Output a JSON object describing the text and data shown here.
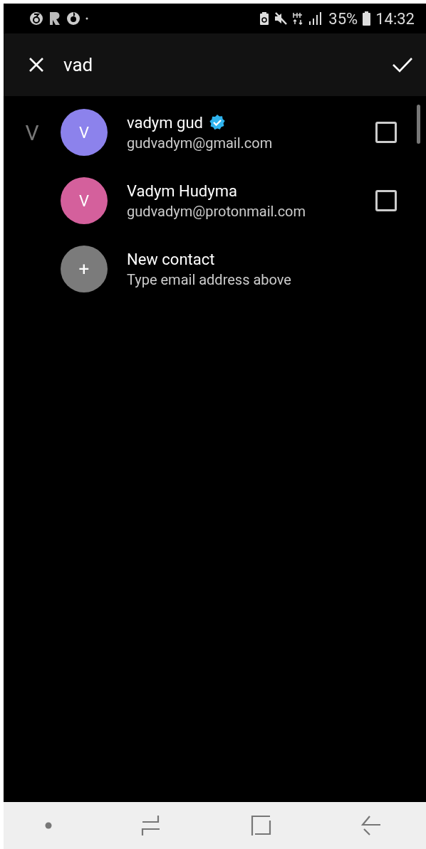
{
  "status_bar": {
    "battery_percent": "35%",
    "time": "14:32"
  },
  "search": {
    "value": "vad"
  },
  "section": {
    "letter": "V"
  },
  "contacts": [
    {
      "kind": "contact",
      "initial": "V",
      "name": "vadym gud",
      "verified": true,
      "email": "gudvadym@gmail.com",
      "color": "#8c82ec",
      "checked": false
    },
    {
      "kind": "contact",
      "initial": "V",
      "name": "Vadym Hudyma",
      "verified": false,
      "email": "gudvadym@protonmail.com",
      "color": "#d4609c",
      "checked": false
    },
    {
      "kind": "new",
      "initial": "+",
      "name": "New contact",
      "email": "Type email address above",
      "color": "#7b7b7b"
    }
  ]
}
